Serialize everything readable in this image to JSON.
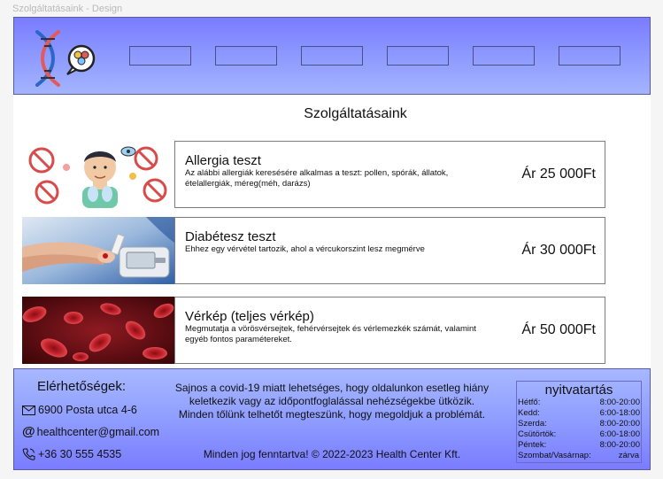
{
  "frame": {
    "title": "Szolgáltatásaink - Design"
  },
  "header": {
    "logo_icon": "dna-chat-logo-icon",
    "nav_buttons": [
      "",
      "",
      "",
      "",
      "",
      ""
    ]
  },
  "section": {
    "title": "Szolgáltatásaink"
  },
  "services": [
    {
      "name": "Allergia teszt",
      "description": "Az alábbi allergiák keresésére alkalmas a teszt: pollen, spórák, állatok, ételallergiák, méreg(méh, darázs)",
      "price": "Ár 25 000Ft",
      "image_icon": "allergy-illustration"
    },
    {
      "name": "Diabétesz teszt",
      "description": "Ehhez egy vérvétel tartozik, ahol a vércukorszint lesz megmérve",
      "price": "Ár 30 000Ft",
      "image_icon": "glucose-meter-photo"
    },
    {
      "name": "Vérkép (teljes vérkép)",
      "description": "Megmutatja a vörösvérsejtek, fehérvérsejtek és vérlemezkék számát, valamint egyéb fontos paramétereket.",
      "price": "Ár 50 000Ft",
      "image_icon": "blood-cells-photo"
    }
  ],
  "footer": {
    "contact_title": "Elérhetőségek:",
    "address": "6900 Posta utca 4-6",
    "email": "healthcenter@gmail.com",
    "phone": "+36 30 555 4535",
    "notice": "Sajnos a covid-19 miatt lehetséges, hogy oldalunkon esetleg hiány keletkezik vagy az időpontfoglalással nehézségekbe ütközik. Minden tőlünk telhetőt megteszünk, hogy megoldjuk a problémát.",
    "copyright": "Minden jog fenntartva! © 2022-2023 Health Center Kft.",
    "hours": {
      "title": "nyitvatartás",
      "rows": [
        {
          "day": "Hétfő:",
          "time": "8:00-20:00"
        },
        {
          "day": "Kedd:",
          "time": "6:00-18:00"
        },
        {
          "day": "Szerda:",
          "time": "8:00-20:00"
        },
        {
          "day": "Csütörtök:",
          "time": "6:00-18:00"
        },
        {
          "day": "Péntek:",
          "time": "8:00-20:00"
        },
        {
          "day": "Szombat/Vasárnap:",
          "time": "zárva"
        }
      ]
    }
  },
  "colors": {
    "header_gradient_top": "#7a7cff",
    "header_gradient_bottom": "#a4b4ff",
    "card_border": "#7d7d7d",
    "nav_border": "#4b4f86"
  }
}
